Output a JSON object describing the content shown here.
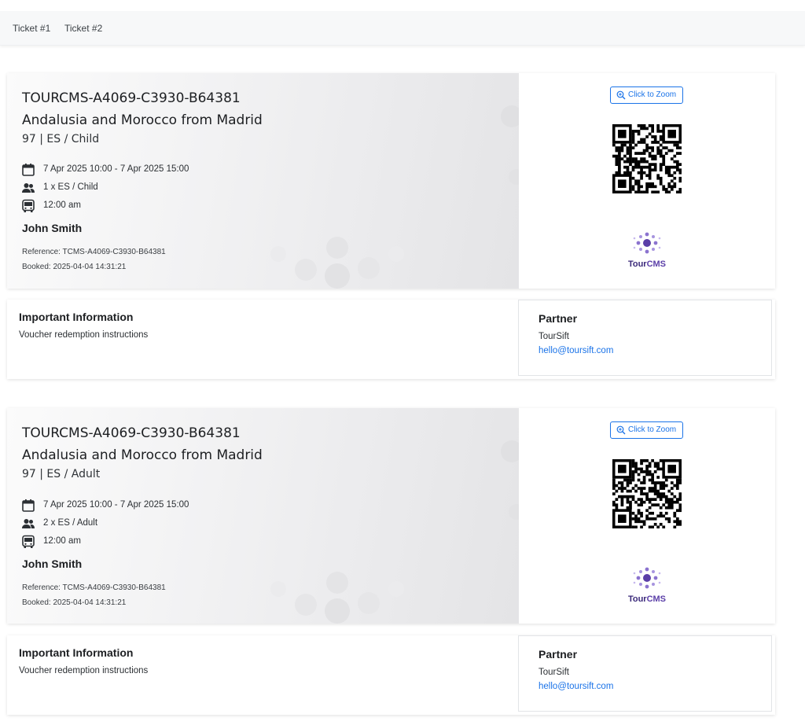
{
  "nav": {
    "tabs": [
      {
        "label": "Ticket #1"
      },
      {
        "label": "Ticket #2"
      }
    ]
  },
  "tickets": [
    {
      "code": "TOURCMS-A4069-C3930-B64381",
      "title": "Andalusia and Morocco from Madrid",
      "subtitle": "97 | ES / Child",
      "date_range": "7 Apr 2025 10:00 - 7 Apr 2025 15:00",
      "quantity": "1 x ES / Child",
      "pickup_time": "12:00 am",
      "customer_name": "John Smith",
      "reference": "Reference: TCMS-A4069-C3930-B64381",
      "booked": "Booked: 2025-04-04 14:31:21",
      "zoom_label": "Click to Zoom",
      "logo_text": {
        "a": "Tour",
        "b": "CMS"
      },
      "info_title": "Important Information",
      "info_text": "Voucher redemption instructions",
      "partner_title": "Partner",
      "partner_name": "TourSift",
      "partner_email": "hello@toursift.com"
    },
    {
      "code": "TOURCMS-A4069-C3930-B64381",
      "title": "Andalusia and Morocco from Madrid",
      "subtitle": "97 | ES / Adult",
      "date_range": "7 Apr 2025 10:00 - 7 Apr 2025 15:00",
      "quantity": "2 x ES / Adult",
      "pickup_time": "12:00 am",
      "customer_name": "John Smith",
      "reference": "Reference: TCMS-A4069-C3930-B64381",
      "booked": "Booked: 2025-04-04 14:31:21",
      "zoom_label": "Click to Zoom",
      "logo_text": {
        "a": "Tour",
        "b": "CMS"
      },
      "info_title": "Important Information",
      "info_text": "Voucher redemption instructions",
      "partner_title": "Partner",
      "partner_name": "TourSift",
      "partner_email": "hello@toursift.com"
    }
  ],
  "icons": {
    "calendar": "calendar-icon",
    "people": "people-icon",
    "bus": "bus-icon",
    "zoom": "zoom-in-icon",
    "qr": "qr-code"
  },
  "colors": {
    "link": "#1a73e8",
    "logo_purple": "#5b3fa8",
    "logo_text": "#3b2a7a"
  }
}
